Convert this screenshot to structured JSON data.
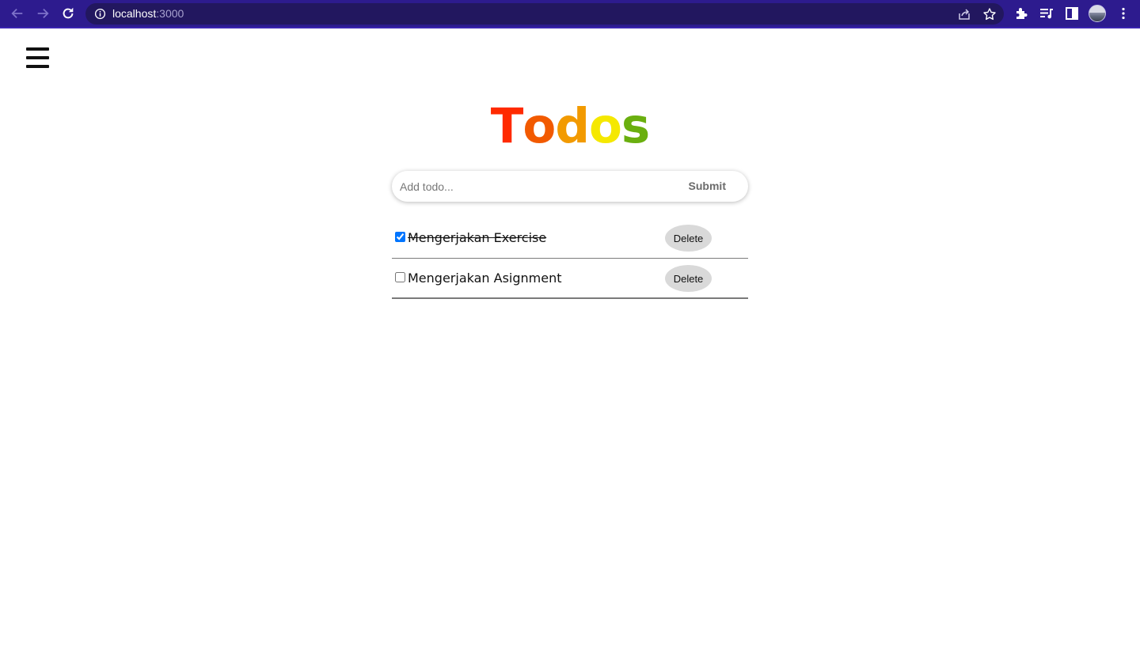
{
  "browser": {
    "url_host": "localhost",
    "url_port": ":3000",
    "icons": {
      "back": "back-arrow-icon",
      "forward": "forward-arrow-icon",
      "reload": "reload-icon",
      "site_info": "info-icon",
      "share": "share-icon",
      "bookmark": "star-icon",
      "extensions": "puzzle-icon",
      "media": "media-queue-icon",
      "side_panel": "side-panel-icon",
      "profile": "profile-avatar",
      "more": "kebab-menu-icon"
    },
    "colors": {
      "frame": "#2d1b8e",
      "omnibox": "#22175f"
    }
  },
  "app": {
    "menu_icon": "hamburger-menu-icon",
    "title": "Todos",
    "title_letters": [
      {
        "char": "T",
        "color": "#ff2a00"
      },
      {
        "char": "o",
        "color": "#f25a00"
      },
      {
        "char": "d",
        "color": "#f29a00"
      },
      {
        "char": "o",
        "color": "#f5e800"
      },
      {
        "char": "s",
        "color": "#6aaf0f"
      }
    ],
    "form": {
      "placeholder": "Add todo...",
      "value": "",
      "submit_label": "Submit"
    },
    "todos": [
      {
        "text": "Mengerjakan Exercise",
        "completed": true,
        "delete_label": "Delete"
      },
      {
        "text": "Mengerjakan Asignment",
        "completed": false,
        "delete_label": "Delete"
      }
    ]
  }
}
